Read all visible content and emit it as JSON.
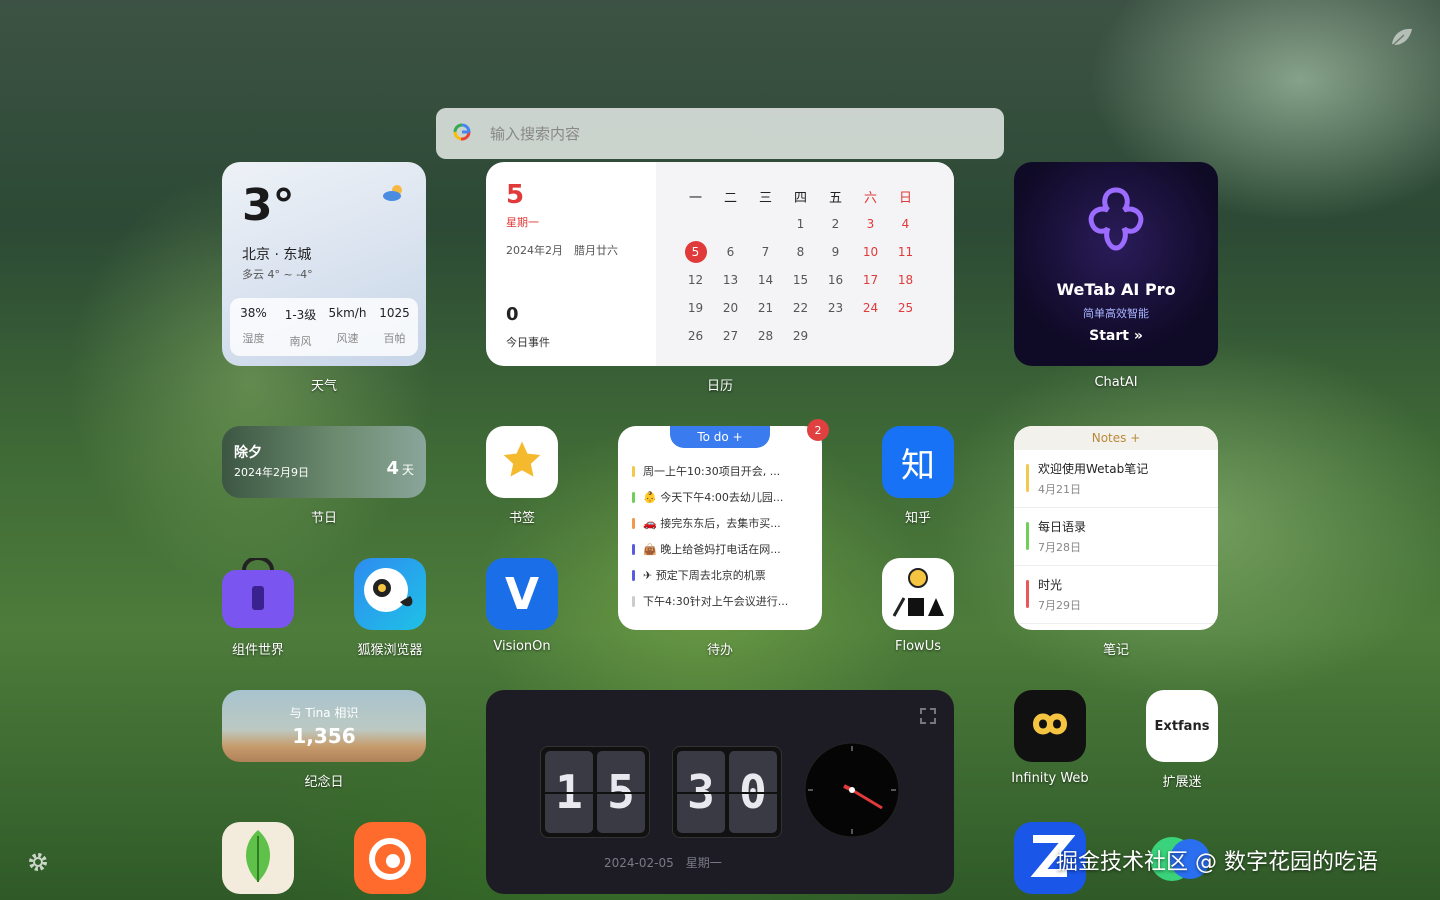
{
  "search": {
    "placeholder": "输入搜索内容"
  },
  "weather": {
    "temp": "3°",
    "city": "北京 · 东城",
    "desc": "多云 4° ~ -4°",
    "stats": [
      {
        "v": "38%",
        "l": "湿度"
      },
      {
        "v": "1-3级",
        "l": "南风"
      },
      {
        "v": "5km/h",
        "l": "风速"
      },
      {
        "v": "1025",
        "l": "百帕"
      }
    ],
    "caption": "天气"
  },
  "calendar": {
    "day": "5",
    "weekday": "星期一",
    "lunar": "2024年2月　腊月廿六",
    "event_count": "0",
    "event_label": "今日事件",
    "caption": "日历",
    "headers": [
      "一",
      "二",
      "三",
      "四",
      "五",
      "六",
      "日"
    ],
    "weeks": [
      [
        "",
        "",
        "",
        "1",
        "2",
        "3",
        "4"
      ],
      [
        "5",
        "6",
        "7",
        "8",
        "9",
        "10",
        "11"
      ],
      [
        "12",
        "13",
        "14",
        "15",
        "16",
        "17",
        "18"
      ],
      [
        "19",
        "20",
        "21",
        "22",
        "23",
        "24",
        "25"
      ],
      [
        "26",
        "27",
        "28",
        "29",
        "",
        "",
        ""
      ]
    ],
    "today": "5"
  },
  "chatai": {
    "title": "WeTab AI Pro",
    "sub": "简单高效智能",
    "start": "Start »",
    "caption": "ChatAI"
  },
  "holiday": {
    "name": "除夕",
    "date": "2024年2月9日",
    "count": "4",
    "unit": "天",
    "caption": "节日"
  },
  "bookmark": {
    "caption": "书签"
  },
  "todo": {
    "header": "To do +",
    "badge": "2",
    "caption": "待办",
    "items": [
      {
        "text": "周一上午10:30项目开会, ...",
        "color": "#f2c94c"
      },
      {
        "text": "👶 今天下午4:00去幼儿园...",
        "color": "#6fcf5a"
      },
      {
        "text": "🚗 接完东东后，去集市买...",
        "color": "#f2994a"
      },
      {
        "text": "👜 晚上给爸妈打电话在网...",
        "color": "#5b5be0"
      },
      {
        "text": "✈ 预定下周去北京的机票",
        "color": "#5b5be0"
      },
      {
        "text": "下午4:30针对上午会议进行...",
        "color": "#cccccc"
      }
    ]
  },
  "zhihu": {
    "glyph": "知",
    "caption": "知乎"
  },
  "notes": {
    "header": "Notes +",
    "caption": "笔记",
    "items": [
      {
        "t": "欢迎使用Wetab笔记",
        "d": "4月21日",
        "color": "#f2c94c"
      },
      {
        "t": "每日语录",
        "d": "7月28日",
        "color": "#6fcf5a"
      },
      {
        "t": "时光",
        "d": "7月29日",
        "color": "#eb5757"
      }
    ]
  },
  "apps": {
    "widgets": "组件世界",
    "foxbrowser": "狐猴浏览器",
    "visionon": "VisionOn",
    "visionon_glyph": "V",
    "flowus": "FlowUs",
    "infinity": "Infinity Web",
    "extfans": "扩展迷",
    "extfans_logo": "Extfans"
  },
  "anniv": {
    "title": "与 Tina 相识",
    "count": "1,356",
    "caption": "纪念日"
  },
  "clock": {
    "h1": "1",
    "h2": "5",
    "m1": "3",
    "m2": "0",
    "date": "2024-02-05　星期一"
  },
  "watermark": "掘金技术社区 @ 数字花园的吃语"
}
